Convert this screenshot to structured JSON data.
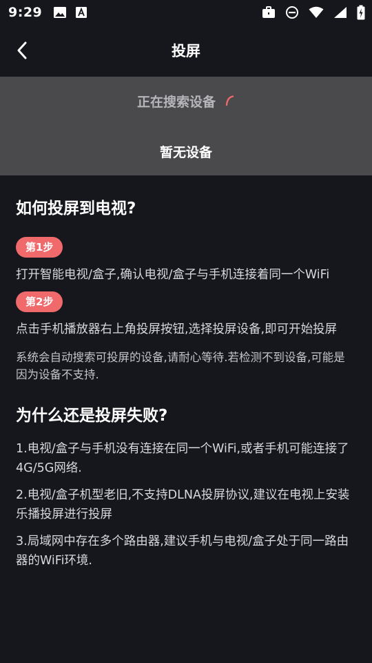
{
  "status_bar": {
    "time": "9:29",
    "left_icons": [
      "image-icon",
      "font-download-icon"
    ],
    "right_icons": [
      "briefcase-icon",
      "do-not-disturb-icon",
      "wifi-icon",
      "signal-icon",
      "battery-charging-icon"
    ]
  },
  "header": {
    "title": "投屏",
    "back_icon": "chevron-left-icon"
  },
  "device_panel": {
    "searching_text": "正在搜索设备",
    "spinner_color": "#f06a6c",
    "empty_text": "暂无设备"
  },
  "howto": {
    "title": "如何投屏到电视?",
    "step1_label": "第1步",
    "step1_text": "打开智能电视/盒子,确认电视/盒子与手机连接着同一个WiFi",
    "step2_label": "第2步",
    "step2_text": "点击手机播放器右上角投屏按钮,选择投屏设备,即可开始投屏",
    "note": "系统会自动搜索可投屏的设备,请耐心等待.若检测不到设备,可能是因为设备不支持."
  },
  "failure": {
    "title": "为什么还是投屏失败?",
    "reasons": [
      "1.电视/盒子与手机没有连接在同一个WiFi,或者手机可能连接了4G/5G网络.",
      "2.电视/盒子机型老旧,不支持DLNA投屏协议,建议在电视上安装乐播投屏进行投屏",
      "3.局域网中存在多个路由器,建议手机与电视/盒子处于同一路由器的WiFi环境."
    ]
  },
  "colors": {
    "background": "#16171d",
    "panel": "#4a4a4d",
    "accent": "#f06a6c"
  }
}
